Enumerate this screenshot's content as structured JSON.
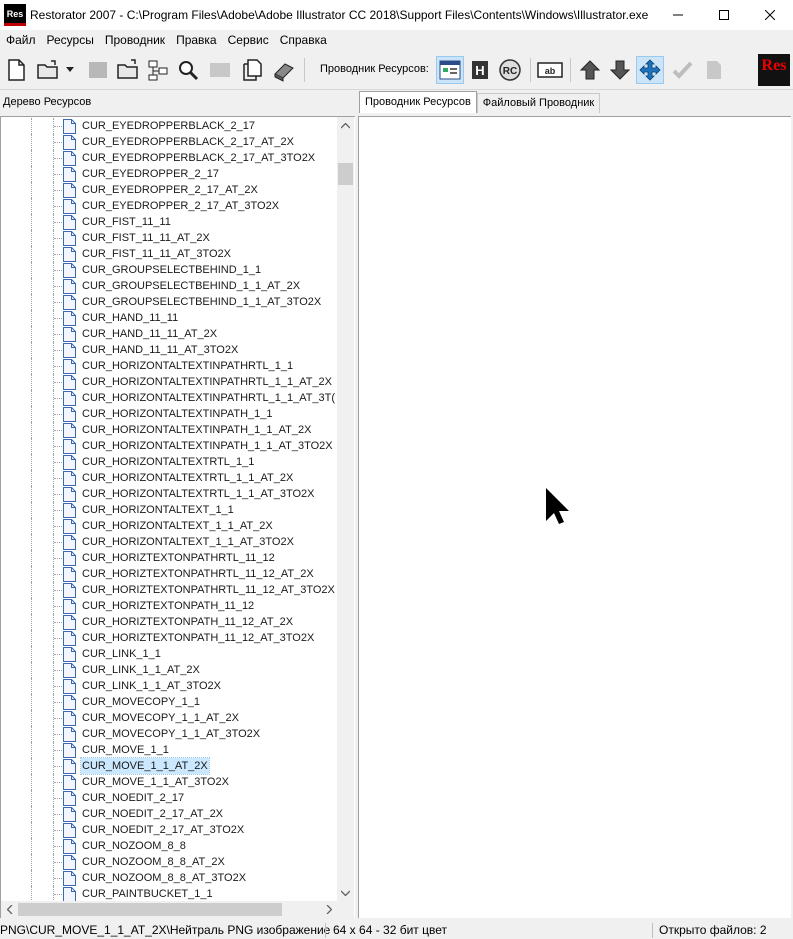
{
  "window": {
    "app_icon_text": "Res",
    "title": "Restorator 2007 - C:\\Program Files\\Adobe\\Adobe Illustrator CC 2018\\Support Files\\Contents\\Windows\\Illustrator.exe"
  },
  "menu": [
    "Файл",
    "Ресурсы",
    "Проводник",
    "Правка",
    "Сервис",
    "Справка"
  ],
  "toolbar": {
    "explorer_label": "Проводник Ресурсов:",
    "logo_text": "Res"
  },
  "tree": {
    "header": "Дерево Ресурсов",
    "items": [
      "CUR_EYEDROPPERBLACK_2_17",
      "CUR_EYEDROPPERBLACK_2_17_AT_2X",
      "CUR_EYEDROPPERBLACK_2_17_AT_3TO2X",
      "CUR_EYEDROPPER_2_17",
      "CUR_EYEDROPPER_2_17_AT_2X",
      "CUR_EYEDROPPER_2_17_AT_3TO2X",
      "CUR_FIST_11_11",
      "CUR_FIST_11_11_AT_2X",
      "CUR_FIST_11_11_AT_3TO2X",
      "CUR_GROUPSELECTBEHIND_1_1",
      "CUR_GROUPSELECTBEHIND_1_1_AT_2X",
      "CUR_GROUPSELECTBEHIND_1_1_AT_3TO2X",
      "CUR_HAND_11_11",
      "CUR_HAND_11_11_AT_2X",
      "CUR_HAND_11_11_AT_3TO2X",
      "CUR_HORIZONTALTEXTINPATHRTL_1_1",
      "CUR_HORIZONTALTEXTINPATHRTL_1_1_AT_2X",
      "CUR_HORIZONTALTEXTINPATHRTL_1_1_AT_3T(",
      "CUR_HORIZONTALTEXTINPATH_1_1",
      "CUR_HORIZONTALTEXTINPATH_1_1_AT_2X",
      "CUR_HORIZONTALTEXTINPATH_1_1_AT_3TO2X",
      "CUR_HORIZONTALTEXTRTL_1_1",
      "CUR_HORIZONTALTEXTRTL_1_1_AT_2X",
      "CUR_HORIZONTALTEXTRTL_1_1_AT_3TO2X",
      "CUR_HORIZONTALTEXT_1_1",
      "CUR_HORIZONTALTEXT_1_1_AT_2X",
      "CUR_HORIZONTALTEXT_1_1_AT_3TO2X",
      "CUR_HORIZTEXTONPATHRTL_11_12",
      "CUR_HORIZTEXTONPATHRTL_11_12_AT_2X",
      "CUR_HORIZTEXTONPATHRTL_11_12_AT_3TO2X",
      "CUR_HORIZTEXTONPATH_11_12",
      "CUR_HORIZTEXTONPATH_11_12_AT_2X",
      "CUR_HORIZTEXTONPATH_11_12_AT_3TO2X",
      "CUR_LINK_1_1",
      "CUR_LINK_1_1_AT_2X",
      "CUR_LINK_1_1_AT_3TO2X",
      "CUR_MOVECOPY_1_1",
      "CUR_MOVECOPY_1_1_AT_2X",
      "CUR_MOVECOPY_1_1_AT_3TO2X",
      "CUR_MOVE_1_1",
      "CUR_MOVE_1_1_AT_2X",
      "CUR_MOVE_1_1_AT_3TO2X",
      "CUR_NOEDIT_2_17",
      "CUR_NOEDIT_2_17_AT_2X",
      "CUR_NOEDIT_2_17_AT_3TO2X",
      "CUR_NOZOOM_8_8",
      "CUR_NOZOOM_8_8_AT_2X",
      "CUR_NOZOOM_8_8_AT_3TO2X",
      "CUR_PAINTBUCKET_1_1"
    ],
    "selected_item": "CUR_MOVE_1_1_AT_2X"
  },
  "tabs": {
    "resource_explorer": "Проводник Ресурсов",
    "file_explorer": "Файловый Проводник"
  },
  "status": {
    "path": "PNG\\CUR_MOVE_1_1_AT_2X\\Нейтраль PNG изображение",
    "image_info": "64 x 64 - 32 бит цвет",
    "open_files": "Открыто файлов: 2"
  }
}
